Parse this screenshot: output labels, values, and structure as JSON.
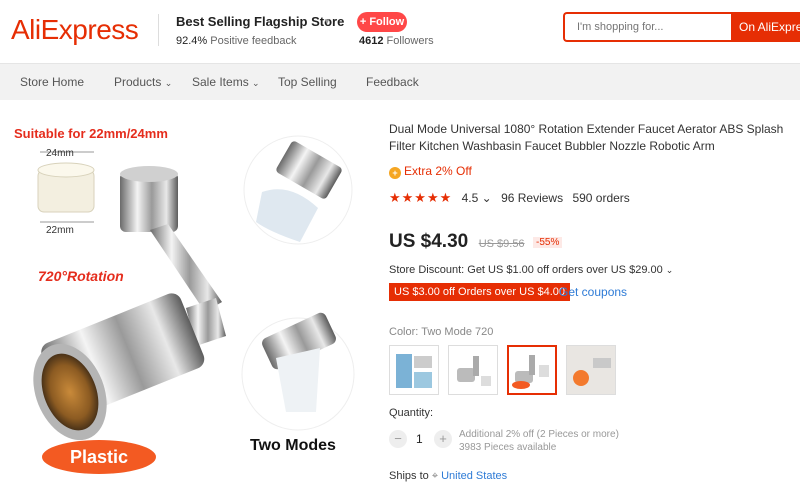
{
  "header": {
    "logo": "AliExpress",
    "store_name": "Best Selling Flagship Store",
    "feedback_pct": "92.4%",
    "feedback_label": "Positive feedback",
    "follow_label": "+ Follow",
    "followers_count": "4612",
    "followers_label": "Followers",
    "search_placeholder": "I'm shopping for...",
    "search_button": "On AliExpress"
  },
  "nav": {
    "items": [
      "Store Home",
      "Products",
      "Sale Items",
      "Top Selling",
      "Feedback"
    ]
  },
  "gallery": {
    "suitable": "Suitable for 22mm/24mm",
    "dim_top": "24mm",
    "dim_bottom": "22mm",
    "rotation": "720°Rotation",
    "two_modes": "Two Modes",
    "plastic": "Plastic"
  },
  "product": {
    "title": "Dual Mode Universal 1080° Rotation Extender Faucet Aerator ABS Splash Filter Kitchen Washbasin Faucet Bubbler Nozzle Robotic Arm",
    "extra_discount": "Extra 2% Off",
    "rating": "4.5",
    "rating_caret": "⌄",
    "reviews": "96 Reviews",
    "orders": "590 orders",
    "price": "US $4.30",
    "original_price": "US $9.56",
    "discount_pct": "-55%",
    "store_discount": "Store Discount: Get US $1.00 off orders over US $29.00",
    "coupon": "US $3.00 off Orders over US $4.00",
    "get_coupons": "Get coupons",
    "color_label": "Color:",
    "color_value": "Two Mode 720",
    "quantity_label": "Quantity:",
    "quantity": "1",
    "qty_note_1": "Additional 2% off (2 Pieces or more)",
    "qty_note_2": "3983 Pieces available",
    "ships_to_label": "Ships to",
    "ships_to": "United States"
  },
  "colors": {
    "brand": "#e62e04",
    "follow": "#ff4747",
    "link": "#2e7bd6"
  }
}
